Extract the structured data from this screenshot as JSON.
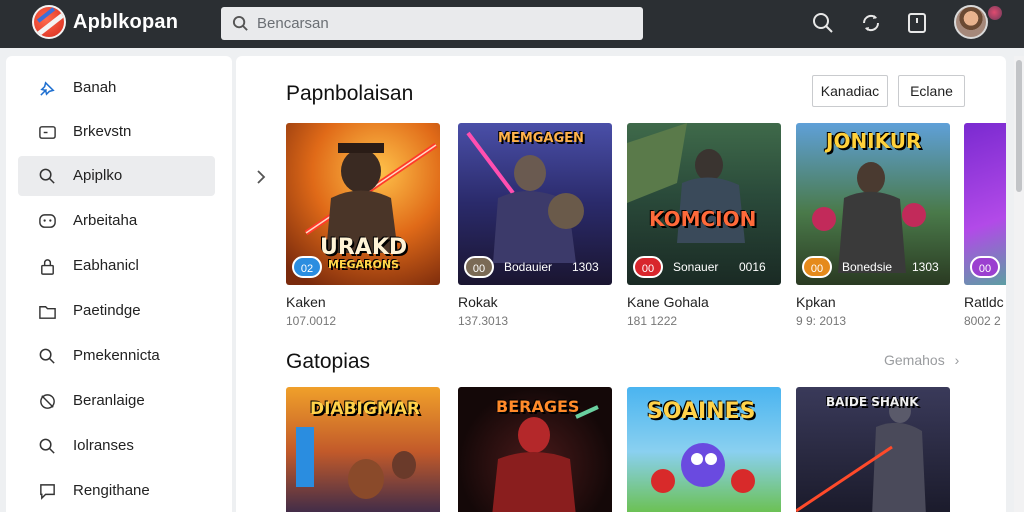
{
  "app": {
    "name": "Apblkopan"
  },
  "search": {
    "placeholder": "Bencarsan"
  },
  "topbar_icons": [
    "search-icon",
    "sync-icon",
    "library-icon",
    "avatar"
  ],
  "sidebar": {
    "items": [
      {
        "label": "Banah",
        "icon": "pin-icon",
        "active": false
      },
      {
        "label": "Brkevstn",
        "icon": "card-icon",
        "active": false
      },
      {
        "label": "Apiplko",
        "icon": "search-icon",
        "active": true
      },
      {
        "label": "Arbeitaha",
        "icon": "chat-icon",
        "active": false
      },
      {
        "label": "Eabhanicl",
        "icon": "lock-icon",
        "active": false
      },
      {
        "label": "Paetindge",
        "icon": "folder-icon",
        "active": false
      },
      {
        "label": "Pmekennicta",
        "icon": "search-icon",
        "active": false
      },
      {
        "label": "Beranlaige",
        "icon": "disabled-icon",
        "active": false
      },
      {
        "label": "Iolranses",
        "icon": "search-icon",
        "active": false
      },
      {
        "label": "Rengithane",
        "icon": "message-icon",
        "active": false
      }
    ]
  },
  "section1": {
    "title": "Papnbolaisan",
    "buttons": {
      "first": "Kanadiac",
      "second": "Eclane"
    },
    "cards": [
      {
        "name": "Kaken",
        "meta": "107.0012",
        "art_title": "URAKD",
        "art_subtitle": "MEGARONS",
        "pill": "02",
        "bar_text": "",
        "bar_num": "",
        "accent": "#2a8de0"
      },
      {
        "name": "Rokak",
        "meta": "137.3013",
        "art_title": "MEMGAGEN",
        "art_subtitle": "",
        "pill": "00",
        "bar_text": "Bodauier",
        "bar_num": "1303",
        "accent": "#7a6a55"
      },
      {
        "name": "Kane Gohala",
        "meta": "181 1222",
        "art_title": "KOMCION",
        "art_subtitle": "",
        "pill": "00",
        "bar_text": "Sonauer",
        "bar_num": "0016",
        "accent": "#d8262c"
      },
      {
        "name": "Kpkan",
        "meta": "9 9: 2013",
        "art_title": "JONIKUR",
        "art_subtitle": "",
        "pill": "00",
        "bar_text": "Bonedsie",
        "bar_num": "1303",
        "accent": "#e58a1c"
      },
      {
        "name": "Ratldc",
        "meta": "8002 2",
        "art_title": "",
        "art_subtitle": "",
        "pill": "00",
        "bar_text": "",
        "bar_num": "",
        "accent": "#9b3fd0"
      }
    ]
  },
  "section2": {
    "title": "Gatopias",
    "see_all": "Gemahos",
    "cards": [
      {
        "art_title": "DIABIGMAR"
      },
      {
        "art_title": "BERAGES"
      },
      {
        "art_title": "SOAINES"
      },
      {
        "art_title": "BAIDE SHANK"
      }
    ]
  },
  "colors": {
    "topbar": "#2b2f33",
    "active_item": "#ebecee",
    "panel": "#ffffff",
    "page_bg": "#eef0f2"
  }
}
